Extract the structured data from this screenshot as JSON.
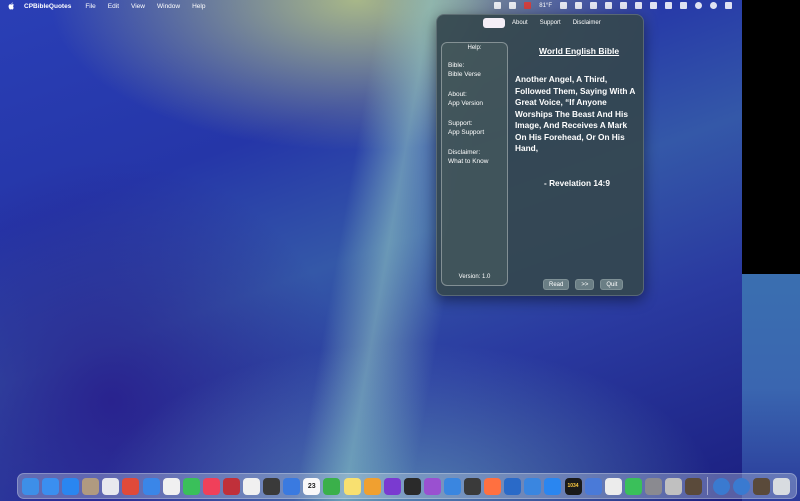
{
  "menubar": {
    "app_name": "CPBibleQuotes",
    "items": [
      "File",
      "Edit",
      "View",
      "Window",
      "Help"
    ],
    "weather": "81°F"
  },
  "app": {
    "tabs": [
      "",
      "About",
      "Support",
      "Disclaimer"
    ],
    "help": {
      "title": "Help:",
      "groups": [
        {
          "heading": "Bible:",
          "detail": "Bible Verse"
        },
        {
          "heading": "About:",
          "detail": "App Version"
        },
        {
          "heading": "Support:",
          "detail": "App Support"
        },
        {
          "heading": "Disclaimer:",
          "detail": "What to Know"
        }
      ],
      "version": "Version: 1.0"
    },
    "bible_title": "World English Bible",
    "verse": "Another Angel, A Third, Followed Them, Saying With A Great Voice, “If Anyone Worships The Beast And His Image, And Receives A Mark On His Forehead, Or On His Hand,",
    "reference": "- Revelation 14:9",
    "buttons": {
      "read": "Read",
      "next": ">>",
      "quit": "Quit"
    }
  },
  "dock": {
    "calendar_day": "23",
    "terminal_label": "1034",
    "icons": [
      {
        "name": "finder-icon",
        "color": "#3d8fe8"
      },
      {
        "name": "mail-icon",
        "color": "#3a8ff0"
      },
      {
        "name": "app-store-icon",
        "color": "#2a86f0"
      },
      {
        "name": "contacts-icon",
        "color": "#b09a80"
      },
      {
        "name": "launchpad-icon",
        "color": "#e8e8ee"
      },
      {
        "name": "chrome-icon",
        "color": "#e04a3a"
      },
      {
        "name": "safari-icon",
        "color": "#3a86e8"
      },
      {
        "name": "news-icon",
        "color": "#f0f0f0"
      },
      {
        "name": "facetime-icon",
        "color": "#3ac05a"
      },
      {
        "name": "music-icon",
        "color": "#f0405a"
      },
      {
        "name": "photo-booth-icon",
        "color": "#c0303a"
      },
      {
        "name": "photos-icon",
        "color": "#f0f0f0"
      },
      {
        "name": "chess-icon",
        "color": "#3a3a3a"
      },
      {
        "name": "xcode-icon",
        "color": "#3a7ae0"
      },
      {
        "name": "calendar-icon",
        "color": "#f8f8f8"
      },
      {
        "name": "numbers-icon",
        "color": "#3ab04a"
      },
      {
        "name": "notes-icon",
        "color": "#f8e070"
      },
      {
        "name": "pages-icon",
        "color": "#f0a030"
      },
      {
        "name": "shortcuts-icon",
        "color": "#7a3ad0"
      },
      {
        "name": "terminal-icon",
        "color": "#2a2a2a"
      },
      {
        "name": "podcasts-icon",
        "color": "#9a50d0"
      },
      {
        "name": "books-icon",
        "color": "#3a86e0"
      },
      {
        "name": "scrivener-icon",
        "color": "#3a3a3a"
      },
      {
        "name": "swift-playgrounds-icon",
        "color": "#ff7040"
      },
      {
        "name": "xcode-hammer-icon",
        "color": "#2a6ac8"
      },
      {
        "name": "downloads-icon",
        "color": "#3a86e0"
      },
      {
        "name": "app-store-2-icon",
        "color": "#2a86f0"
      },
      {
        "name": "clock-icon",
        "color": "#1a1a1a"
      },
      {
        "name": "preview-icon",
        "color": "#4a7ad8"
      },
      {
        "name": "vpn-icon",
        "color": "#ececec"
      },
      {
        "name": "phone-icon",
        "color": "#3ac05a"
      },
      {
        "name": "system-settings-icon",
        "color": "#8a8a90"
      },
      {
        "name": "photo-app-icon",
        "color": "#c0c0c0"
      },
      {
        "name": "bible-app-icon",
        "color": "#5a4a3a"
      }
    ],
    "right_icons": [
      {
        "name": "globe-icon",
        "color": "#3a7ad0"
      },
      {
        "name": "globe-2-icon",
        "color": "#3a7ad0"
      },
      {
        "name": "archive-icon",
        "color": "#5a4a3a"
      },
      {
        "name": "trash-icon",
        "color": "#d8dce0"
      }
    ]
  }
}
